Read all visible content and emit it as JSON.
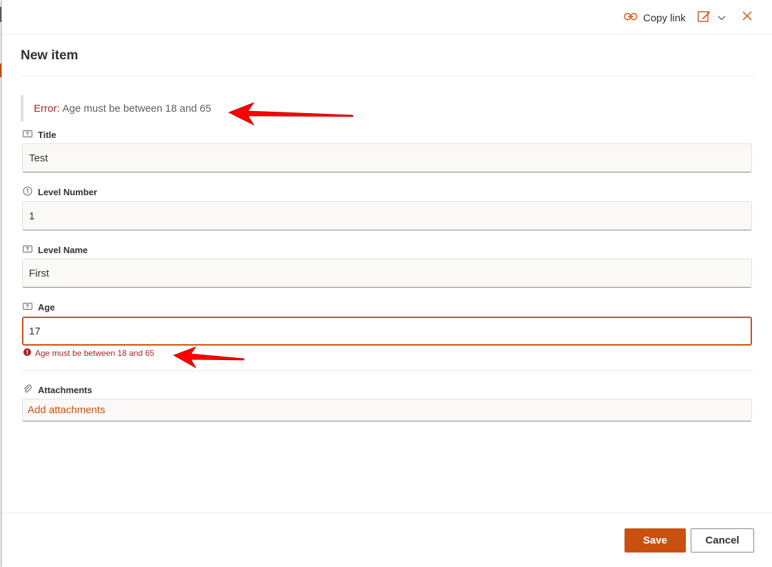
{
  "header": {
    "copy_link_label": "Copy link",
    "copy_link_icon": "link-icon",
    "edit_icon": "edit-form-icon",
    "chevron_icon": "chevron-down-icon",
    "close_icon": "close-icon"
  },
  "form": {
    "title": "New item",
    "error_banner": {
      "prefix": "Error:",
      "message": "Age must be between 18 and 65"
    },
    "fields": [
      {
        "label": "Title",
        "icon": "text-field-icon",
        "value": "Test"
      },
      {
        "label": "Level Number",
        "icon": "number-field-icon",
        "value": "1"
      },
      {
        "label": "Level Name",
        "icon": "text-field-icon",
        "value": "First"
      },
      {
        "label": "Age",
        "icon": "text-field-icon",
        "value": "17",
        "error": "Age must be between 18 and 65"
      }
    ],
    "attachments": {
      "label": "Attachments",
      "icon": "paperclip-icon",
      "add_label": "Add attachments"
    }
  },
  "footer": {
    "save_label": "Save",
    "cancel_label": "Cancel"
  },
  "colors": {
    "accent": "#ca5010",
    "error": "#a4262c",
    "annotation_arrow": "#ff0000"
  }
}
